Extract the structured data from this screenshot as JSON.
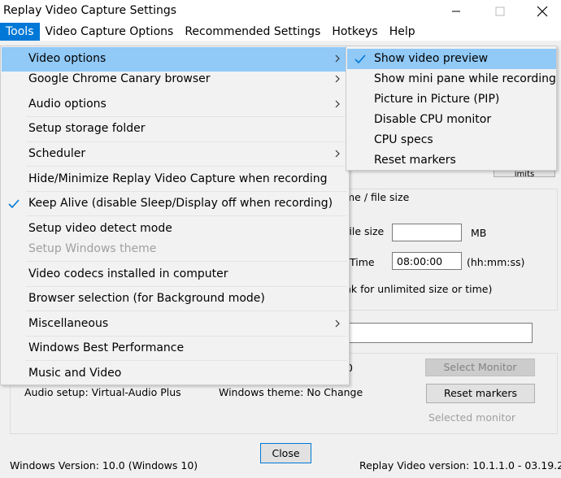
{
  "window": {
    "title": "Replay Video Capture Settings"
  },
  "menubar": {
    "items": [
      {
        "label": "Tools"
      },
      {
        "label": "Video Capture Options"
      },
      {
        "label": "Recommended Settings"
      },
      {
        "label": "Hotkeys"
      },
      {
        "label": "Help"
      }
    ]
  },
  "tools_menu": {
    "items": [
      {
        "label": "Video options",
        "submenu": true,
        "highlighted": true
      },
      {
        "label": "Google Chrome Canary browser",
        "submenu": true
      },
      {
        "label": "Audio options",
        "submenu": true
      },
      {
        "label": "Setup storage folder"
      },
      {
        "label": "Scheduler",
        "submenu": true
      },
      {
        "label": "Hide/Minimize Replay Video Capture when recording"
      },
      {
        "label": "Keep Alive (disable Sleep/Display off when recording)",
        "checked": true
      },
      {
        "label": "Setup video detect mode"
      },
      {
        "label": "Setup Windows theme",
        "disabled": true
      },
      {
        "label": "Video codecs installed in computer"
      },
      {
        "label": "Browser selection (for Background mode)"
      },
      {
        "label": "Miscellaneous",
        "submenu": true
      },
      {
        "label": "Windows Best Performance"
      },
      {
        "label": "Music and Video"
      }
    ]
  },
  "video_options_submenu": {
    "items": [
      {
        "label": "Show video preview",
        "checked": true,
        "highlighted": true
      },
      {
        "label": "Show mini pane while recording"
      },
      {
        "label": "Picture in Picture (PIP)"
      },
      {
        "label": "Disable CPU monitor"
      },
      {
        "label": "CPU specs"
      },
      {
        "label": "Reset markers"
      }
    ]
  },
  "limits": {
    "group_label": "me / file size",
    "file_size_label": "file size",
    "file_size_value": "",
    "file_size_unit": "MB",
    "time_label": "Time",
    "time_value": "08:00:00",
    "time_unit": "(hh:mm:ss)",
    "note": "nk for unlimited size or time)",
    "limits_button_partial": "imits"
  },
  "status": {
    "audio_setup": "Audio setup: Virtual-Audio Plus",
    "windows_theme": "Windows theme: No Change",
    "partial_digit": "0",
    "select_monitor_button": "Select Monitor",
    "reset_markers_button": "Reset markers",
    "selected_monitor_label": "Selected monitor"
  },
  "footer": {
    "close_button": "Close",
    "windows_version": "Windows Version: 10.0 (Windows 10)",
    "app_version": "Replay Video version: 10.1.1.0 - 03.19.21"
  }
}
